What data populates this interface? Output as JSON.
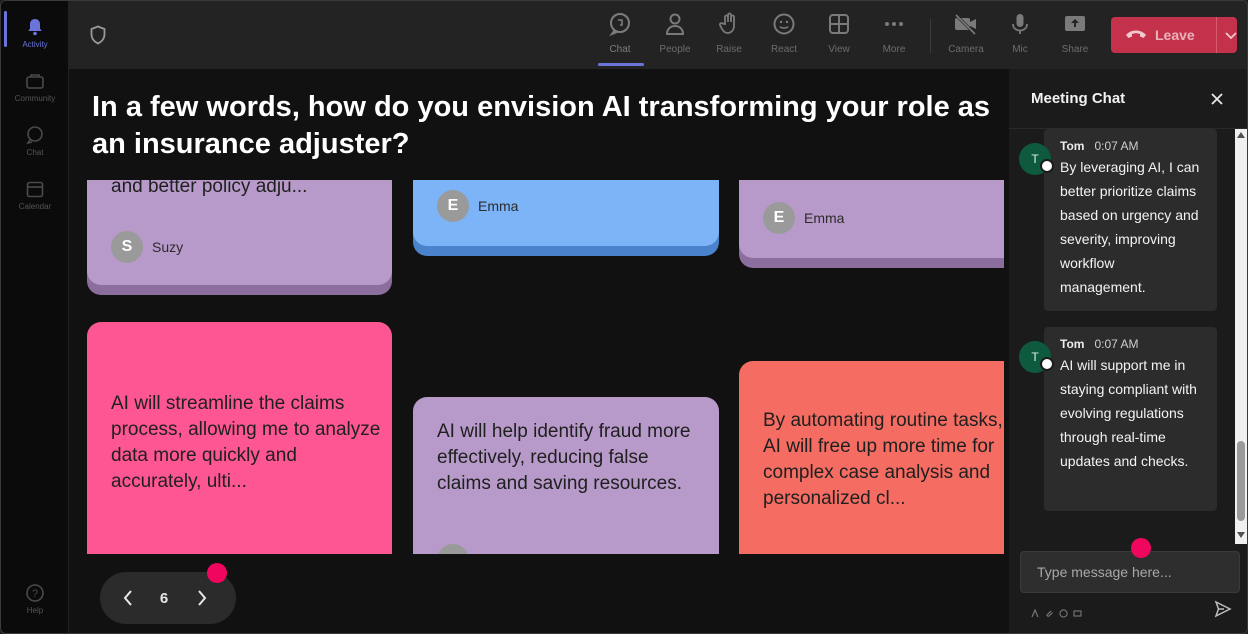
{
  "rail": {
    "items": [
      {
        "label": "Activity",
        "icon": "bell-icon"
      },
      {
        "label": "Community",
        "icon": "community-icon"
      },
      {
        "label": "Chat",
        "icon": "chat-icon"
      },
      {
        "label": "Calendar",
        "icon": "calendar-icon"
      }
    ],
    "help": {
      "label": "Help",
      "icon": "help-icon"
    }
  },
  "toolbar": {
    "buttons": [
      {
        "label": "Chat",
        "icon": "chat-icon"
      },
      {
        "label": "People",
        "icon": "people-icon"
      },
      {
        "label": "Raise",
        "icon": "raise-hand-icon"
      },
      {
        "label": "React",
        "icon": "smile-icon"
      },
      {
        "label": "View",
        "icon": "grid-icon"
      },
      {
        "label": "More",
        "icon": "more-icon"
      },
      {
        "label": "Camera",
        "icon": "camera-off-icon"
      },
      {
        "label": "Mic",
        "icon": "mic-icon"
      },
      {
        "label": "Share",
        "icon": "share-icon"
      }
    ],
    "leave_label": "Leave",
    "leave_color": "#c4314b",
    "accent_color": "#6b74d9"
  },
  "stage": {
    "question": "In a few words, how do you envision AI transforming your role as an insurance adjuster?",
    "cards": [
      {
        "text": "and better policy adju...",
        "author": "Suzy",
        "initial": "S"
      },
      {
        "text": "",
        "author": "Emma",
        "initial": "E"
      },
      {
        "text": "",
        "author": "Emma",
        "initial": "E"
      },
      {
        "text": "AI will streamline the claims process, allowing me to analyze data more quickly and accurately, ulti...",
        "author": "",
        "initial": ""
      },
      {
        "text": "AI will help identify fraud more effectively, reducing false claims and saving resources.",
        "author": "",
        "initial": ""
      },
      {
        "text": "By automating routine tasks, AI will free up more time for complex case analysis and personalized cl...",
        "author": "",
        "initial": ""
      }
    ],
    "pager": {
      "page": "6"
    }
  },
  "chat": {
    "title": "Meeting Chat",
    "messages": [
      {
        "author": "Tom",
        "initial": "T",
        "time": "0:07 AM",
        "text": "By leveraging AI, I can better prioritize claims based on urgency and severity, improving workflow management."
      },
      {
        "author": "Tom",
        "initial": "T",
        "time": "0:07 AM",
        "text": "AI will support me in staying compliant with evolving regulations through real-time updates and checks."
      }
    ],
    "input_placeholder": "Type message here..."
  }
}
